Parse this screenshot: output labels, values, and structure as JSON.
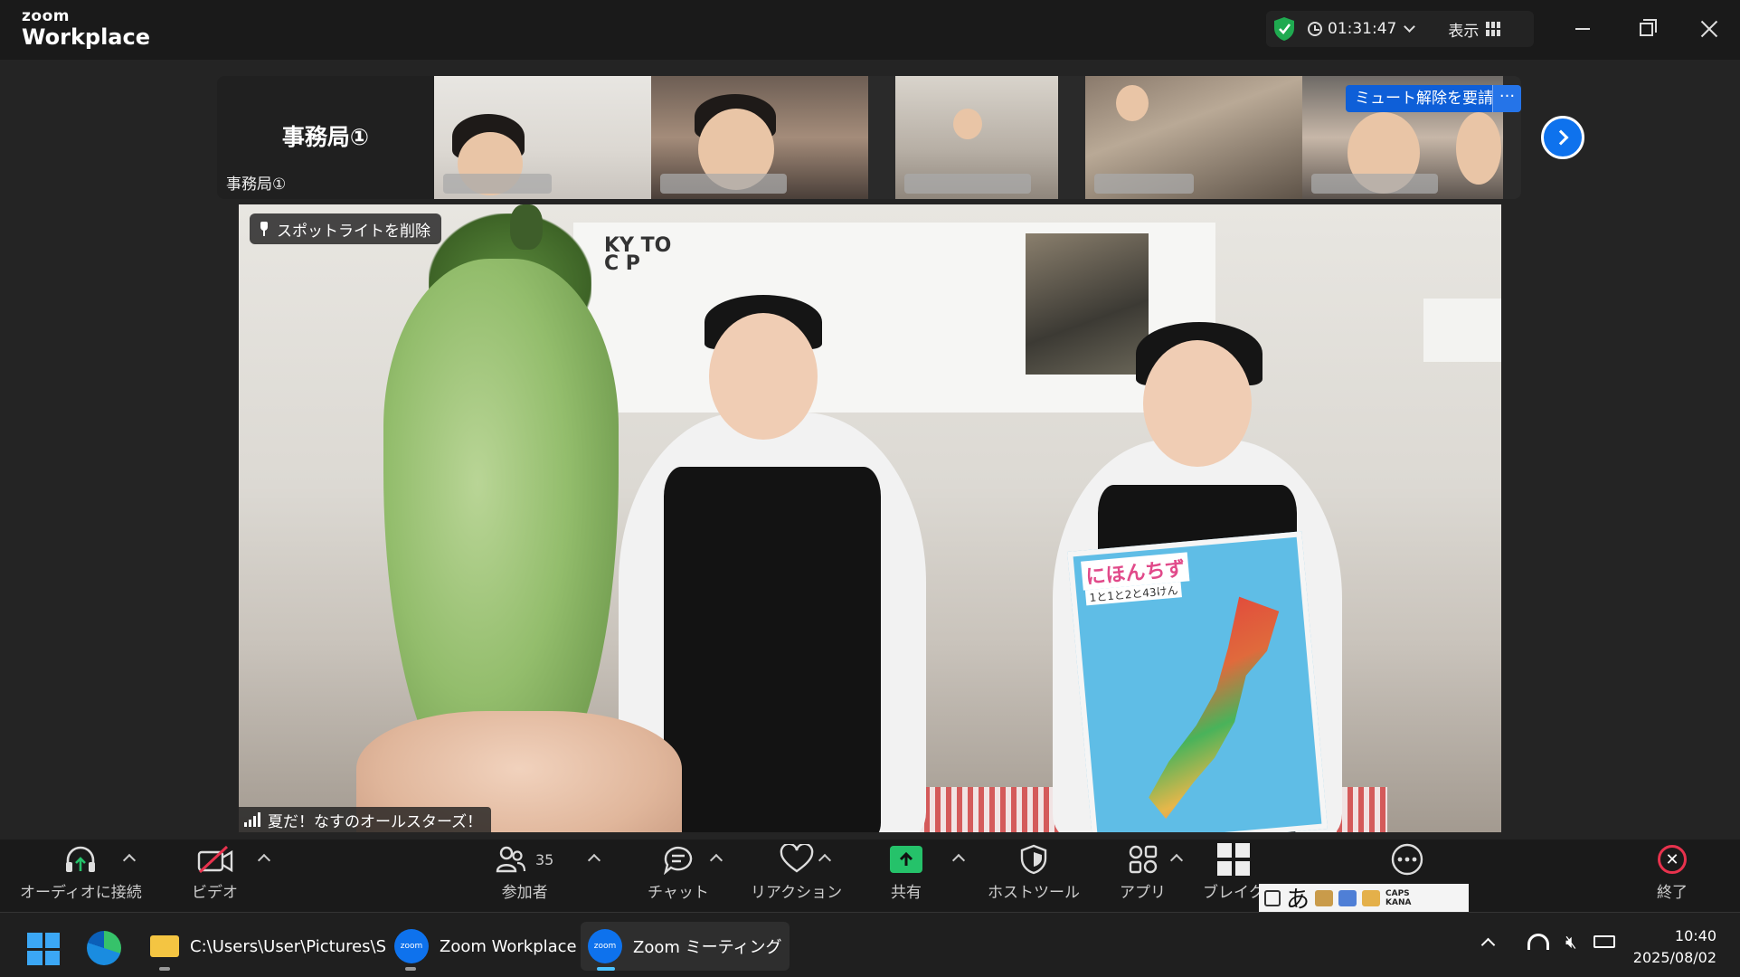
{
  "titlebar": {
    "brand_top": "zoom",
    "brand_bottom": "Workplace",
    "timer": "01:31:47",
    "view_label": "表示"
  },
  "strip": {
    "name_card_big": "事務局①",
    "name_card_small": "事務局①",
    "unmute_request": "ミュート解除を要請",
    "more": "···"
  },
  "main": {
    "spotlight_remove": "スポットライトを削除",
    "speaker_name": "夏だ！なすのオールスターズ！"
  },
  "toolbar": {
    "audio": "オーディオに接続",
    "video": "ビデオ",
    "participants": "参加者",
    "participants_count": "35",
    "chat": "チャット",
    "reactions": "リアクション",
    "share": "共有",
    "host_tools": "ホストツール",
    "apps": "アプリ",
    "breakout": "ブレイク",
    "end": "終了"
  },
  "ime": {
    "char": "あ",
    "caps": "CAPS",
    "kana": "KANA"
  },
  "taskbar": {
    "explorer_path": "C:\\Users\\User\\Pictures\\S",
    "zoom_workplace": "Zoom Workplace",
    "zoom_meeting": "Zoom ミーティング",
    "zoom_icon_text": "zoom",
    "time": "10:40",
    "date": "2025/08/02"
  },
  "colors": {
    "accent_blue": "#0e72ed",
    "share_green": "#25c26a",
    "end_red": "#e8324d",
    "secure_green": "#1faa50"
  }
}
